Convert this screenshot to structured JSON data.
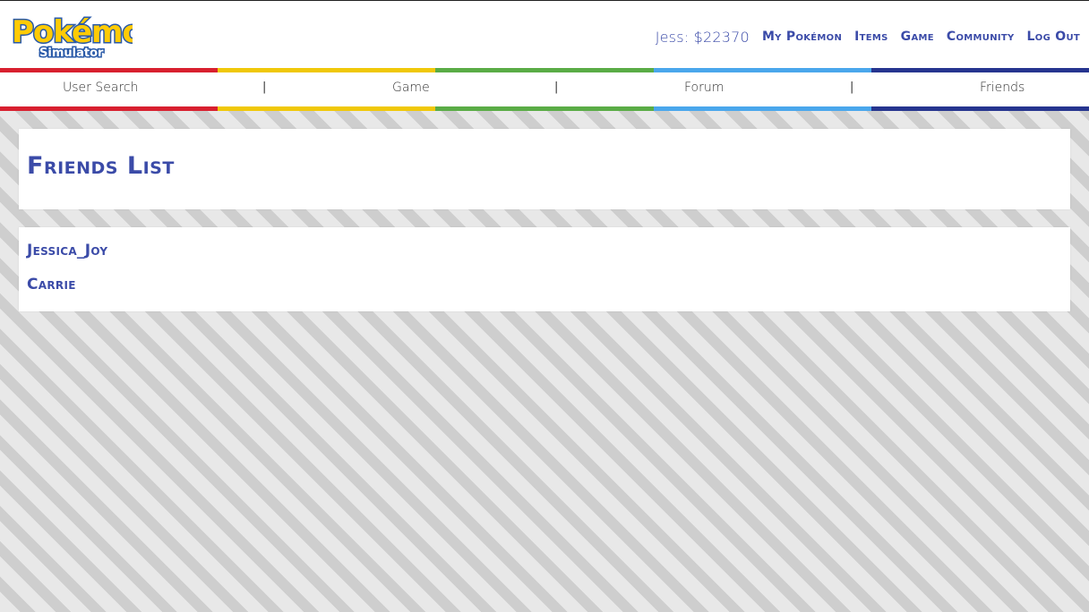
{
  "header": {
    "logo": {
      "text": "Pokémon",
      "subtitle": "Simulator"
    },
    "user": {
      "name": "Jess",
      "separator": ":",
      "balance": "$22370"
    },
    "nav": [
      "My Pokémon",
      "Items",
      "Game",
      "Community",
      "Log Out"
    ]
  },
  "colors": {
    "accent": "#3b4ba8",
    "stripe": [
      "#d8202f",
      "#f0c80a",
      "#5aac46",
      "#4aa7ec",
      "#26358f"
    ]
  },
  "subnav": {
    "items": [
      "User Search",
      "Game",
      "Forum",
      "Friends"
    ],
    "divider": "|"
  },
  "main": {
    "title": "Friends List",
    "friends": [
      "Jessica_Joy",
      "Carrie"
    ]
  }
}
